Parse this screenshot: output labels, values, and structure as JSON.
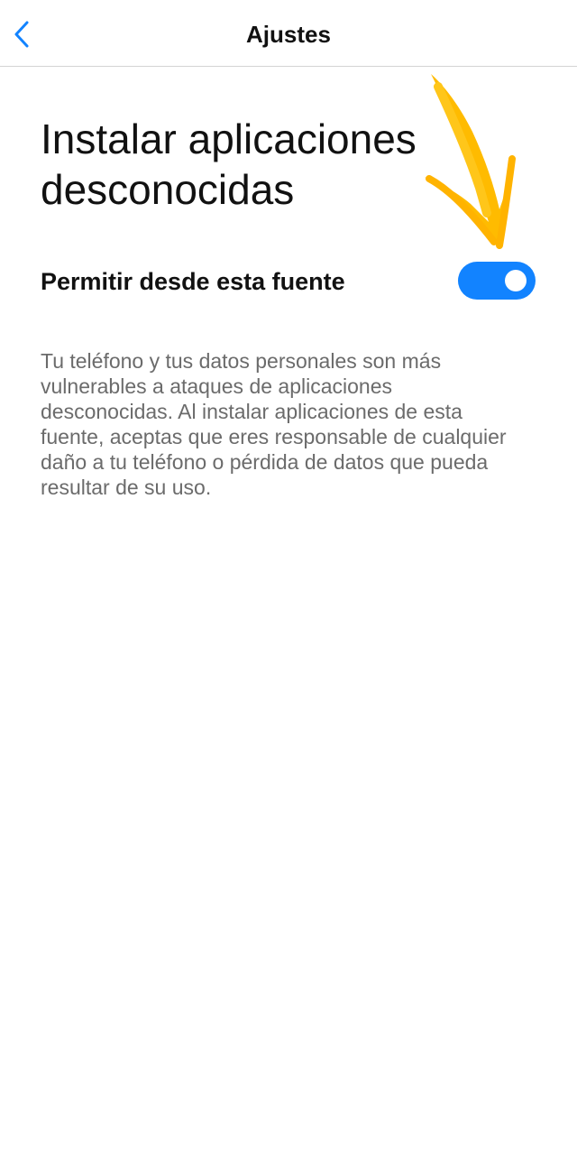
{
  "header": {
    "title": "Ajustes",
    "back_icon": "chevron-left-icon"
  },
  "main": {
    "title": "Instalar aplicaciones desconocidas",
    "setting": {
      "label": "Permitir desde esta fuente",
      "enabled": true
    },
    "description": "Tu teléfono y tus datos personales son más vulnerables a ataques de aplicaciones desconocidas. Al instalar aplicaciones de esta fuente, aceptas que eres responsable de cualquier daño a tu teléfono o pérdida de datos que pueda resultar de su uso."
  },
  "annotation": {
    "icon": "arrow-down-icon",
    "color": "#ffbb00"
  },
  "colors": {
    "accent": "#1283ff",
    "divider": "#d4d4d4",
    "secondary_text": "#6b6b6b"
  }
}
